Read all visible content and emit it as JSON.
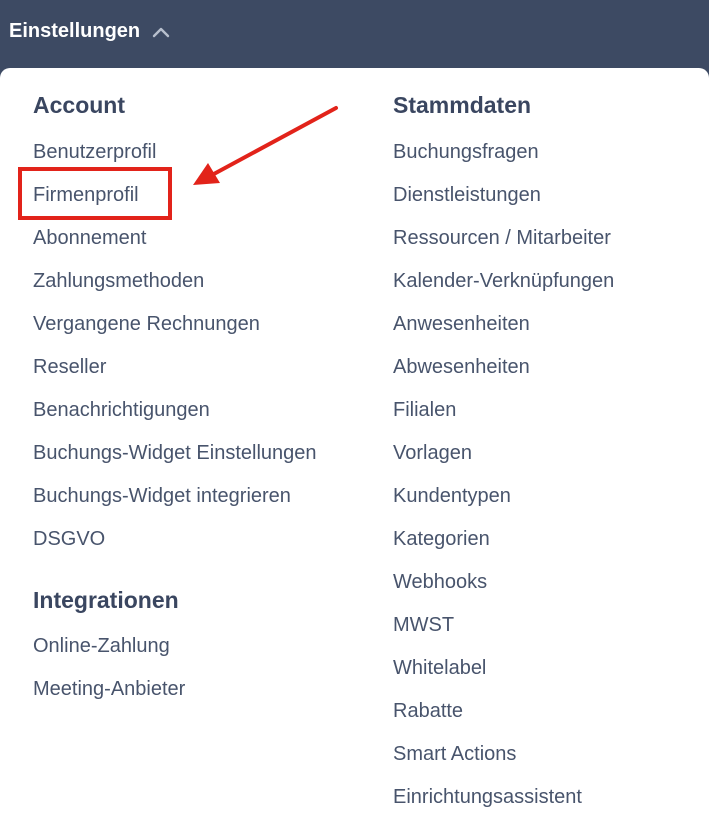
{
  "menu": {
    "title": "Einstellungen",
    "chevron_icon": "chevron-up-icon"
  },
  "account": {
    "heading": "Account",
    "items": [
      "Benutzerprofil",
      "Firmenprofil",
      "Abonnement",
      "Zahlungsmethoden",
      "Vergangene Rechnungen",
      "Reseller",
      "Benachrichtigungen",
      "Buchungs-Widget Einstellungen",
      "Buchungs-Widget integrieren",
      "DSGVO"
    ]
  },
  "integrationen": {
    "heading": "Integrationen",
    "items": [
      "Online-Zahlung",
      "Meeting-Anbieter"
    ]
  },
  "stammdaten": {
    "heading": "Stammdaten",
    "items": [
      "Buchungsfragen",
      "Dienstleistungen",
      "Ressourcen / Mitarbeiter",
      "Kalender-Verknüpfungen",
      "Anwesenheiten",
      "Abwesenheiten",
      "Filialen",
      "Vorlagen",
      "Kundentypen",
      "Kategorien",
      "Webhooks",
      "MWST",
      "Whitelabel",
      "Rabatte",
      "Smart Actions",
      "Einrichtungsassistent"
    ]
  },
  "annotation": {
    "highlight_color": "#e2231a",
    "highlighted_item": "Firmenprofil"
  },
  "colors": {
    "topbar": "#3d4a63",
    "heading": "#3a4660",
    "item": "#48546c"
  }
}
